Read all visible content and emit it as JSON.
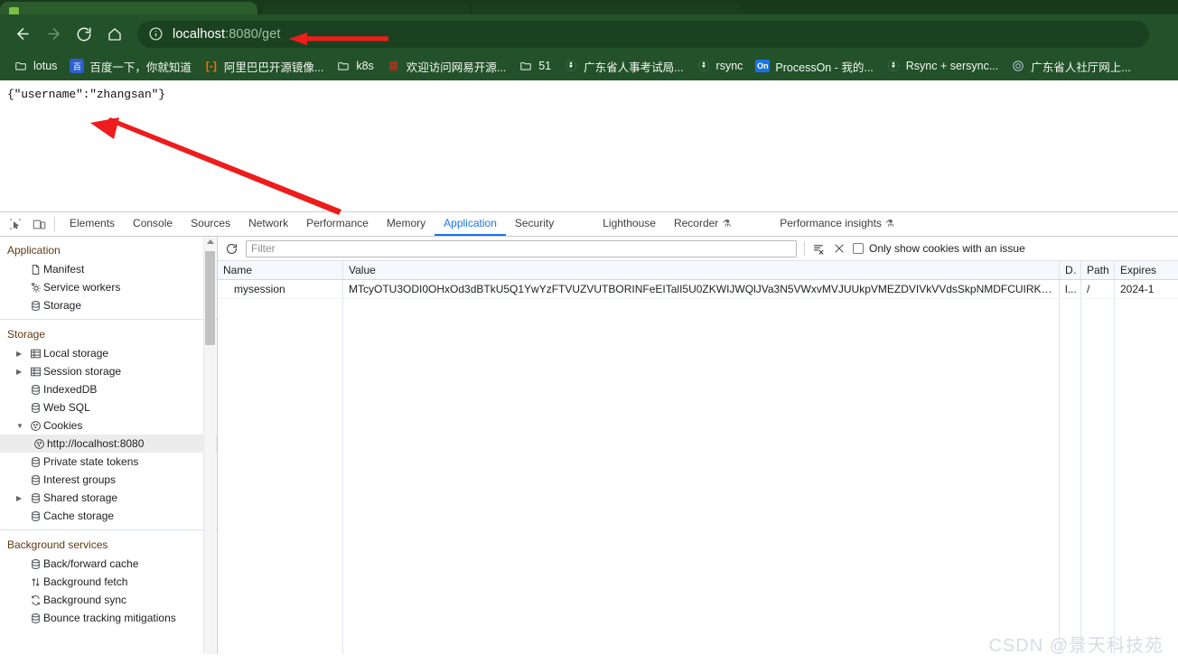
{
  "browser": {
    "tabs": [
      {
        "title": "",
        "active": true
      },
      {
        "title": "",
        "active": false
      },
      {
        "title": "",
        "active": false
      }
    ],
    "nav": {
      "back_label": "Back",
      "forward_label": "Forward",
      "reload_label": "Reload",
      "home_label": "Home"
    },
    "omnibox": {
      "site_info_icon": "info-circle-icon",
      "host": "localhost",
      "path": ":8080/get",
      "full_url": "localhost:8080/get"
    },
    "bookmarks": [
      {
        "label": "lotus",
        "icon": "folder-icon"
      },
      {
        "label": "百度一下，你就知道",
        "icon": "baidu-icon"
      },
      {
        "label": "阿里巴巴开源镜像...",
        "icon": "alibaba-icon"
      },
      {
        "label": "k8s",
        "icon": "folder-icon"
      },
      {
        "label": "欢迎访问网易开源...",
        "icon": "netease-icon"
      },
      {
        "label": "51",
        "icon": "folder-icon"
      },
      {
        "label": "广东省人事考试局...",
        "icon": "globe-icon"
      },
      {
        "label": "rsync",
        "icon": "globe-icon"
      },
      {
        "label": "ProcessOn - 我的...",
        "icon": "processon-icon"
      },
      {
        "label": "Rsync + sersync...",
        "icon": "globe-icon"
      },
      {
        "label": "广东省人社厅网上...",
        "icon": "gov-icon"
      }
    ],
    "theme_color": "#23522a"
  },
  "page_content": {
    "body_text": "{\"username\":\"zhangsan\"}"
  },
  "annotations": {
    "arrow_color": "#ee1c1c",
    "arrows": [
      {
        "name": "url-arrow",
        "points": "from (415,43) to (330,43)"
      },
      {
        "name": "response-arrow",
        "points": "from (365,232) to (110,137)"
      }
    ]
  },
  "devtools": {
    "left_buttons": [
      {
        "name": "inspect-element-icon",
        "label": "Inspect element"
      },
      {
        "name": "device-toolbar-icon",
        "label": "Toggle device toolbar"
      }
    ],
    "tabs": [
      {
        "label": "Elements",
        "active": false,
        "flask": false
      },
      {
        "label": "Console",
        "active": false,
        "flask": false
      },
      {
        "label": "Sources",
        "active": false,
        "flask": false
      },
      {
        "label": "Network",
        "active": false,
        "flask": false
      },
      {
        "label": "Performance",
        "active": false,
        "flask": false
      },
      {
        "label": "Memory",
        "active": false,
        "flask": false
      },
      {
        "label": "Application",
        "active": true,
        "flask": false
      },
      {
        "label": "Security",
        "active": false,
        "flask": false
      },
      {
        "label": "Lighthouse",
        "active": false,
        "flask": false
      },
      {
        "label": "Recorder",
        "active": false,
        "flask": true
      },
      {
        "label": "Performance insights",
        "active": false,
        "flask": true
      }
    ],
    "sidebar": {
      "sections": [
        {
          "header": "Application",
          "items": [
            {
              "label": "Manifest",
              "icon": "document-icon",
              "indent": 1,
              "expandable": false,
              "selected": false
            },
            {
              "label": "Service workers",
              "icon": "gears-icon",
              "indent": 1,
              "expandable": false,
              "selected": false
            },
            {
              "label": "Storage",
              "icon": "database-icon",
              "indent": 1,
              "expandable": false,
              "selected": false
            }
          ]
        },
        {
          "header": "Storage",
          "items": [
            {
              "label": "Local storage",
              "icon": "table-icon",
              "indent": 1,
              "expandable": true,
              "expanded": false,
              "selected": false
            },
            {
              "label": "Session storage",
              "icon": "table-icon",
              "indent": 1,
              "expandable": true,
              "expanded": false,
              "selected": false
            },
            {
              "label": "IndexedDB",
              "icon": "database-icon",
              "indent": 1,
              "expandable": false,
              "selected": false
            },
            {
              "label": "Web SQL",
              "icon": "database-icon",
              "indent": 1,
              "expandable": false,
              "selected": false
            },
            {
              "label": "Cookies",
              "icon": "cookie-icon",
              "indent": 1,
              "expandable": true,
              "expanded": true,
              "selected": false
            },
            {
              "label": "http://localhost:8080",
              "icon": "cookie-icon",
              "indent": 2,
              "expandable": false,
              "selected": true
            },
            {
              "label": "Private state tokens",
              "icon": "database-icon",
              "indent": 1,
              "expandable": false,
              "selected": false
            },
            {
              "label": "Interest groups",
              "icon": "database-icon",
              "indent": 1,
              "expandable": false,
              "selected": false
            },
            {
              "label": "Shared storage",
              "icon": "database-icon",
              "indent": 1,
              "expandable": true,
              "expanded": false,
              "selected": false
            },
            {
              "label": "Cache storage",
              "icon": "database-icon",
              "indent": 1,
              "expandable": false,
              "selected": false
            }
          ]
        },
        {
          "header": "Background services",
          "items": [
            {
              "label": "Back/forward cache",
              "icon": "database-icon",
              "indent": 1,
              "expandable": false,
              "selected": false
            },
            {
              "label": "Background fetch",
              "icon": "arrows-updown-icon",
              "indent": 1,
              "expandable": false,
              "selected": false
            },
            {
              "label": "Background sync",
              "icon": "sync-icon",
              "indent": 1,
              "expandable": false,
              "selected": false
            },
            {
              "label": "Bounce tracking mitigations",
              "icon": "database-icon",
              "indent": 1,
              "expandable": false,
              "selected": false
            }
          ]
        }
      ]
    },
    "cookies_toolbar": {
      "refresh_icon": "refresh-icon",
      "filter_placeholder": "Filter",
      "filter_value": "",
      "clear_all_icon": "clear-all-cookies-icon",
      "delete_icon": "delete-cookie-icon",
      "issue_checkbox_label": "Only show cookies with an issue",
      "issue_checkbox_checked": false
    },
    "cookies_table": {
      "columns": [
        "Name",
        "Value",
        "D...",
        "Path",
        "Expires"
      ],
      "rows": [
        {
          "name": "mysession",
          "value": "MTcyOTU3ODI0OHxOd3dBTkU5Q1YwYzFTVUZVUTBORINFeEITalI5U0ZKWIJWQlJVa3N5VWxvMVJUUkpVMEZDVIVkVVdsSkpNMDFCUIRKTFVraE9OR...",
          "domain": "l...",
          "path": "/",
          "expires": "2024-1"
        }
      ]
    }
  },
  "watermark": {
    "text": "CSDN @景天科技苑"
  }
}
